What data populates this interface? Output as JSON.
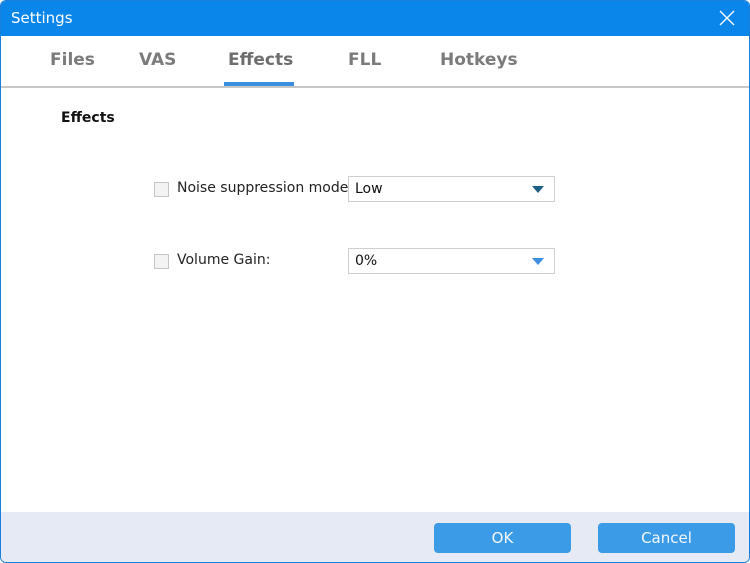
{
  "window": {
    "title": "Settings"
  },
  "tabs": [
    {
      "label": "Files"
    },
    {
      "label": "VAS"
    },
    {
      "label": "Effects"
    },
    {
      "label": "FLL"
    },
    {
      "label": "Hotkeys"
    }
  ],
  "active_tab": "Effects",
  "section_title": "Effects",
  "noise": {
    "label": "Noise suppression mode",
    "checked": false,
    "value": "Low"
  },
  "gain": {
    "label": "Volume Gain:",
    "checked": false,
    "value": "0%"
  },
  "footer": {
    "ok": "OK",
    "cancel": "Cancel"
  },
  "colors": {
    "titlebar": "#0a86ea",
    "button": "#3c9be6",
    "footer": "#e6eaf5"
  }
}
